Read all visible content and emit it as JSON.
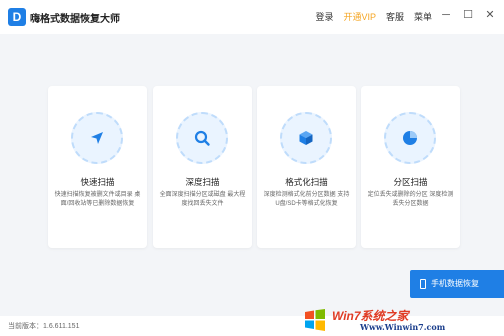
{
  "app": {
    "title": "嗨格式数据恢复大师"
  },
  "top_links": {
    "login": "登录",
    "vip": "开通VIP",
    "service": "客服",
    "menu": "菜单"
  },
  "window_controls": {
    "minimize": "─",
    "maximize": "☐",
    "close": "✕"
  },
  "cards": [
    {
      "title": "快速扫描",
      "desc": "快速扫描恢复被删文件或目录 桌面/回收站等已删除数据恢复",
      "icon": "navigation-arrow-icon"
    },
    {
      "title": "深度扫描",
      "desc": "全面深度扫描分区或磁盘 最大程度找回丢失文件",
      "icon": "magnifier-icon"
    },
    {
      "title": "格式化扫描",
      "desc": "深度检测格式化前分区数据 支持U盘/SD卡等格式化恢复",
      "icon": "cube-icon"
    },
    {
      "title": "分区扫描",
      "desc": "定位丢失或删除的分区 深度检测丢失分区数据",
      "icon": "pie-chart-icon"
    }
  ],
  "mobile_recovery": {
    "label": "手机数据恢复"
  },
  "status": {
    "version": "当前版本：1.6.611.151"
  },
  "watermark": {
    "brand": "Win7系统之家",
    "url": "Www.Winwin7.com"
  },
  "colors": {
    "accent": "#1f7fe5",
    "vip": "#f5a623",
    "background": "#f3f5f8"
  }
}
